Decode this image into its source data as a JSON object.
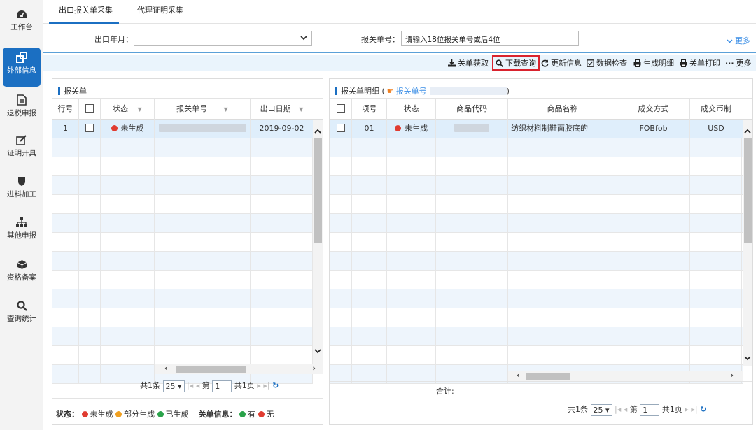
{
  "sidebar": {
    "items": [
      {
        "label": "工作台",
        "icon": "dashboard-icon"
      },
      {
        "label": "外部信息",
        "icon": "external-info-icon",
        "active": true
      },
      {
        "label": "退税申报",
        "icon": "document-icon"
      },
      {
        "label": "证明开具",
        "icon": "edit-icon"
      },
      {
        "label": "进料加工",
        "icon": "shield-icon"
      },
      {
        "label": "其他申报",
        "icon": "org-chart-icon"
      },
      {
        "label": "资格备案",
        "icon": "cube-icon"
      },
      {
        "label": "查询统计",
        "icon": "search-icon"
      }
    ]
  },
  "tabs": [
    {
      "label": "出口报关单采集",
      "active": true
    },
    {
      "label": "代理证明采集",
      "active": false
    }
  ],
  "filter": {
    "month_label": "出口年月：",
    "month_value": "",
    "declaration_label": "报关单号：",
    "declaration_placeholder": "请输入18位报关单号或后4位",
    "more": "更多"
  },
  "toolbar": {
    "fetch": "关单获取",
    "download_query": "下载查询",
    "update": "更新信息",
    "check": "数据检查",
    "generate": "生成明细",
    "print": "关单打印",
    "more": "更多"
  },
  "left_panel": {
    "title": "报关单",
    "columns": [
      "行号",
      "",
      "状态",
      "报关单号",
      "出口日期"
    ],
    "rows": [
      {
        "row_no": "1",
        "status": "未生成",
        "status_color": "#e03c31",
        "declaration_no": "",
        "date": "2019-09-02"
      }
    ],
    "pager": {
      "total": "共1条",
      "page_size": "25",
      "page_label": "第",
      "page": "1",
      "pages": "共1页"
    }
  },
  "right_panel": {
    "title": "报关单明细 (",
    "title_link": "报关单号",
    "title_close": ")",
    "columns": [
      "",
      "项号",
      "状态",
      "商品代码",
      "商品名称",
      "成交方式",
      "成交币制"
    ],
    "rows": [
      {
        "item_no": "01",
        "status": "未生成",
        "status_color": "#e03c31",
        "goods_code": "",
        "goods_name": "纺织材料制鞋面胶底的",
        "deal_mode": "FOBfob",
        "currency": "USD"
      }
    ],
    "total_label": "合计:",
    "pager": {
      "total": "共1条",
      "page_size": "25",
      "page_label": "第",
      "page": "1",
      "pages": "共1页"
    }
  },
  "legend": {
    "status_label": "状态：",
    "not_generated": "未生成",
    "partial": "部分生成",
    "generated": "已生成",
    "info_label": "关单信息：",
    "has": "有",
    "none": "无",
    "colors": {
      "red": "#e03c31",
      "orange": "#f0a020",
      "green": "#2aa34a"
    }
  }
}
